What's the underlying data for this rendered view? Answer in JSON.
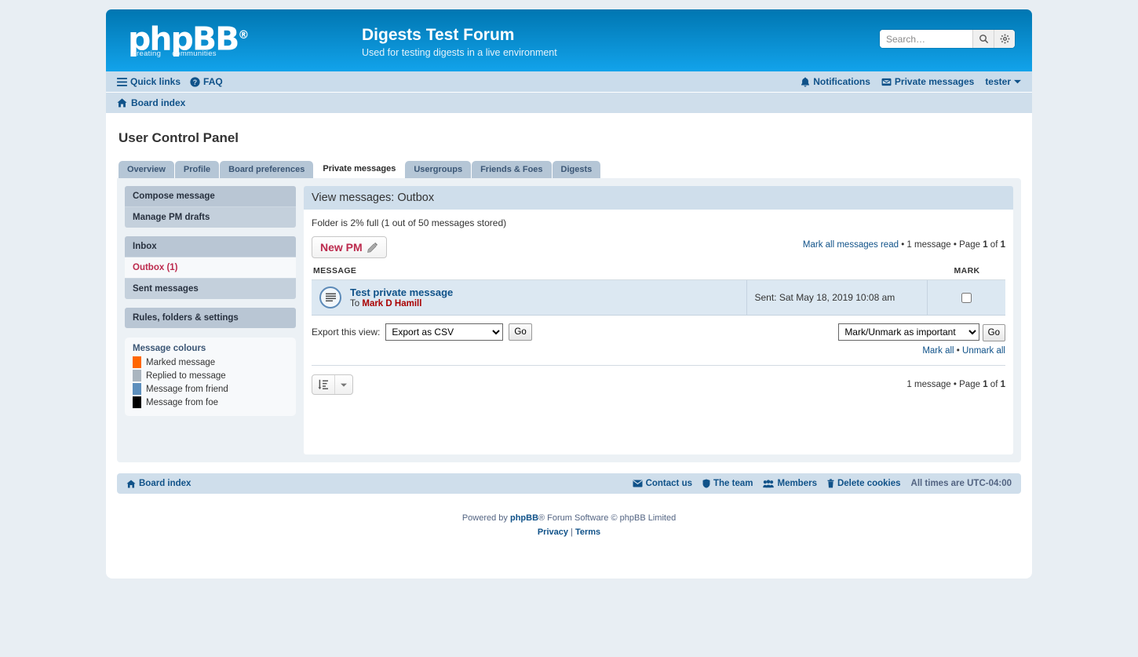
{
  "header": {
    "logo_main": "phpBB",
    "logo_reg": "®",
    "logo_sub_left": "creating",
    "logo_sub_right": "communities",
    "site_title": "Digests Test Forum",
    "site_description": "Used for testing digests in a live environment",
    "search_placeholder": "Search…",
    "search_value": ""
  },
  "navbar": {
    "quick_links": "Quick links",
    "faq": "FAQ",
    "notifications": "Notifications",
    "private_messages": "Private messages",
    "username": "tester"
  },
  "breadcrumb": {
    "board_index": "Board index"
  },
  "ucp": {
    "title": "User Control Panel",
    "tabs": [
      {
        "label": "Overview",
        "active": false
      },
      {
        "label": "Profile",
        "active": false
      },
      {
        "label": "Board preferences",
        "active": false
      },
      {
        "label": "Private messages",
        "active": true
      },
      {
        "label": "Usergroups",
        "active": false
      },
      {
        "label": "Friends & Foes",
        "active": false
      },
      {
        "label": "Digests",
        "active": false
      }
    ]
  },
  "sidebar": {
    "groups": [
      {
        "items": [
          {
            "label": "Compose message",
            "active": false
          },
          {
            "label": "Manage PM drafts",
            "active": false
          }
        ]
      },
      {
        "items": [
          {
            "label": "Inbox",
            "active": false
          },
          {
            "label": "Outbox (1)",
            "active": true
          },
          {
            "label": "Sent messages",
            "active": false
          }
        ]
      },
      {
        "items": [
          {
            "label": "Rules, folders & settings",
            "active": false
          }
        ]
      }
    ],
    "legend": {
      "title": "Message colours",
      "items": [
        {
          "label": "Marked message",
          "color": "#ff6600"
        },
        {
          "label": "Replied to message",
          "color": "#aab5bf"
        },
        {
          "label": "Message from friend",
          "color": "#5d8fbd"
        },
        {
          "label": "Message from foe",
          "color": "#000000"
        }
      ]
    }
  },
  "content": {
    "heading": "View messages: Outbox",
    "folder_status": "Folder is 2% full (1 out of 50 messages stored)",
    "new_pm_label": "New PM",
    "mark_all_read": "Mark all messages read",
    "pager_count": "1 message",
    "pager_page_word": "Page",
    "pager_current": "1",
    "pager_of": "of",
    "pager_total": "1",
    "columns": {
      "message": "MESSAGE",
      "mark": "MARK"
    },
    "messages": [
      {
        "subject": "Test private message",
        "to_label": "To",
        "to_user": "Mark D Hamill",
        "sent": "Sent: Sat May 18, 2019 10:08 am",
        "marked": false
      }
    ],
    "export_label": "Export this view:",
    "export_selected": "Export as CSV",
    "export_options": [
      "Export as CSV"
    ],
    "export_go": "Go",
    "mark_action_selected": "Mark/Unmark as important",
    "mark_action_options": [
      "Mark/Unmark as important"
    ],
    "mark_action_go": "Go",
    "mark_all": "Mark all",
    "mark_sep": "•",
    "unmark_all": "Unmark all"
  },
  "footer": {
    "board_index": "Board index",
    "contact_us": "Contact us",
    "the_team": "The team",
    "members": "Members",
    "delete_cookies": "Delete cookies",
    "timezone": "All times are UTC-04:00",
    "powered_by": "Powered by",
    "phpbb": "phpBB",
    "copyright_tail": "® Forum Software © phpBB Limited",
    "privacy": "Privacy",
    "divider": "|",
    "terms": "Terms"
  },
  "colors": {
    "header_top": "#0076b1",
    "header_bottom": "#12a3eb",
    "link": "#105289",
    "accent_red": "#bc2a4d",
    "row_bg": "#dce8f2"
  }
}
